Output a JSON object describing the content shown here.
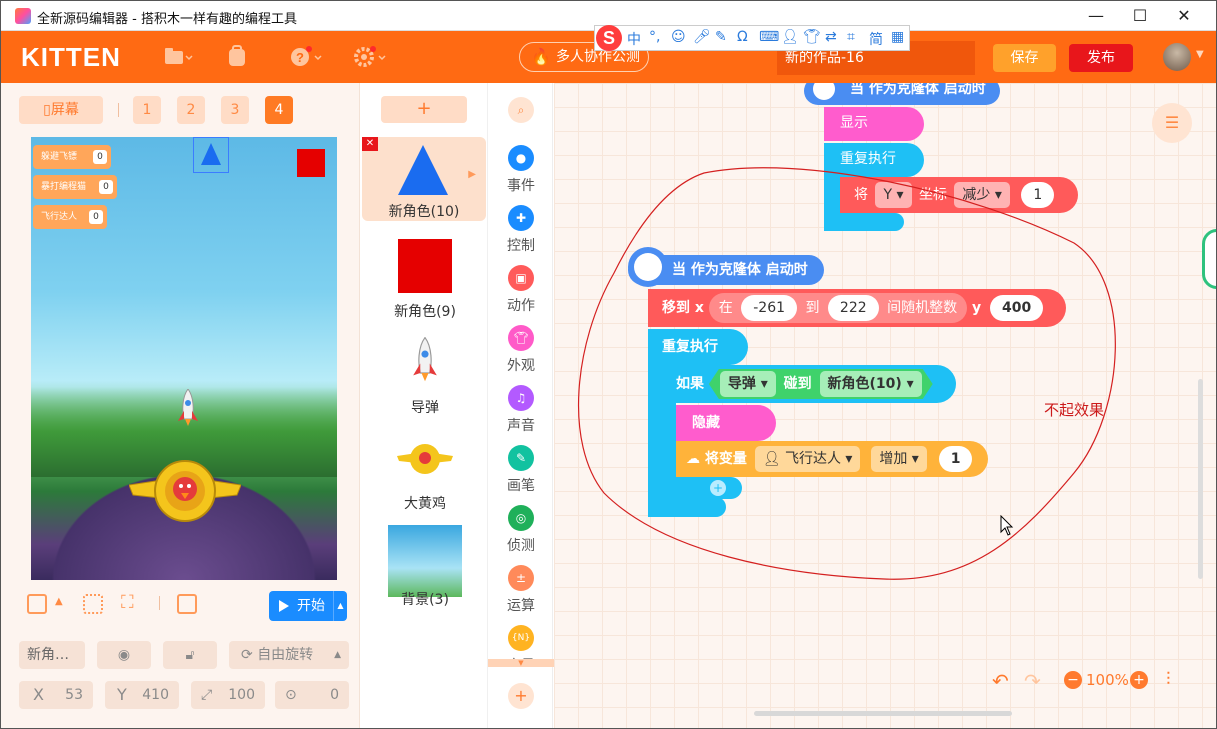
{
  "window": {
    "title": "全新源码编辑器 - 搭积木一样有趣的编程工具",
    "minimize": "—",
    "maximize": "☐",
    "close": "✕"
  },
  "header": {
    "logo": "KITTEN",
    "collab_label": "多人协作公测",
    "project_name": "新的作品-16",
    "save_label": "保存",
    "publish_label": "发布",
    "ime_chars": [
      "中",
      "简"
    ]
  },
  "left": {
    "screen_label": "屏幕",
    "screen_numbers": [
      "1",
      "2",
      "3",
      "4"
    ],
    "active_screen": "4",
    "variables": [
      {
        "name": "躲避飞镖",
        "value": "0"
      },
      {
        "name": "暴打编程猫",
        "value": "0"
      },
      {
        "name": "飞行达人",
        "value": "0"
      }
    ],
    "start_label": "开始",
    "sprite_name": "新角…",
    "rotation_label": "自由旋转",
    "x_label": "X",
    "x_value": "53",
    "y_label": "Y",
    "y_value": "410",
    "size_value": "100",
    "direction_value": "0"
  },
  "sprites": {
    "add_label": "+",
    "items": [
      {
        "label": "新角色(10)"
      },
      {
        "label": "新角色(9)"
      },
      {
        "label": "导弹"
      },
      {
        "label": "大黄鸡"
      },
      {
        "label": "背景(3)"
      }
    ]
  },
  "categories": [
    {
      "label": "事件",
      "color": "#1a8cff"
    },
    {
      "label": "控制",
      "color": "#1a8cff"
    },
    {
      "label": "动作",
      "color": "#ff5a5a"
    },
    {
      "label": "外观",
      "color": "#ff5ac8"
    },
    {
      "label": "声音",
      "color": "#b35aff"
    },
    {
      "label": "画笔",
      "color": "#12c2a0"
    },
    {
      "label": "侦测",
      "color": "#1fb05a"
    },
    {
      "label": "运算",
      "color": "#ff8a5a"
    },
    {
      "label": "变量",
      "color": "#ffb321"
    }
  ],
  "blocks": {
    "top_hat": "当 作为克隆体 启动时",
    "show": "显示",
    "repeat1": "重复执行",
    "set_y": {
      "prefix": "将",
      "axis": "Y",
      "coord": "坐标",
      "op": "减少",
      "value": "1"
    },
    "hat2": "当 作为克隆体 启动时",
    "move_to": {
      "prefix": "移到 x",
      "at": "在",
      "min": "-261",
      "to": "到",
      "max": "222",
      "rand": "间随机整数",
      "y": "y",
      "yval": "400"
    },
    "repeat2": "重复执行",
    "if_block": {
      "prefix": "如果",
      "sprite": "导弹",
      "touch": "碰到",
      "target": "新角色(10)"
    },
    "hide": "隐藏",
    "change_var": {
      "prefix": "将变量",
      "var": "飞行达人",
      "op": "增加",
      "value": "1"
    },
    "plus": "+"
  },
  "annotation": "不起效果",
  "zoom": {
    "value": "100%"
  }
}
